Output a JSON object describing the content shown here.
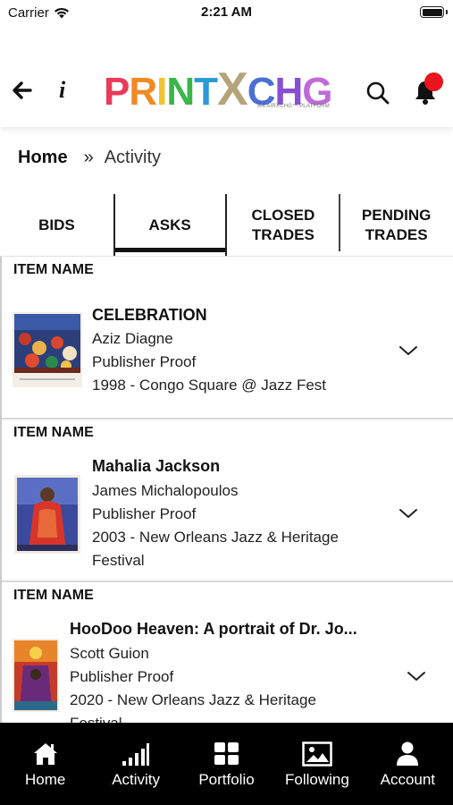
{
  "status": {
    "carrier": "Carrier",
    "time": "2:21 AM"
  },
  "header": {
    "logo": {
      "part1": "PRINT",
      "part2": "X",
      "part3": "CHG",
      "sub": "AN AIRXCHG™ PLATFORM"
    }
  },
  "breadcrumb": {
    "home": "Home",
    "separator": "»",
    "current": "Activity"
  },
  "tabs": [
    {
      "label_line1": "BIDS",
      "label_line2": "",
      "active": false
    },
    {
      "label_line1": "ASKS",
      "label_line2": "",
      "active": true
    },
    {
      "label_line1": "CLOSED",
      "label_line2": "TRADES",
      "active": false
    },
    {
      "label_line1": "PENDING",
      "label_line2": "TRADES",
      "active": false
    }
  ],
  "items": [
    {
      "header": "ITEM NAME",
      "title": "CELEBRATION",
      "artist": "Aziz Diagne",
      "edition": "Publisher Proof",
      "event_line1": "1998 - Congo Square @ Jazz Fest",
      "event_line2": ""
    },
    {
      "header": "ITEM NAME",
      "title": "Mahalia Jackson",
      "artist": "James Michalopoulos",
      "edition": "Publisher Proof",
      "event_line1": "2003 - New Orleans Jazz & Heritage",
      "event_line2": "Festival"
    },
    {
      "header": "ITEM NAME",
      "title": "HooDoo Heaven: A portrait of Dr. Jo...",
      "artist": "Scott Guion",
      "edition": "Publisher Proof",
      "event_line1": "2020 - New Orleans Jazz & Heritage",
      "event_line2": "Festival"
    }
  ],
  "nav": [
    {
      "label": "Home",
      "icon": "home-icon"
    },
    {
      "label": "Activity",
      "icon": "activity-bars-icon"
    },
    {
      "label": "Portfolio",
      "icon": "grid-icon"
    },
    {
      "label": "Following",
      "icon": "image-icon"
    },
    {
      "label": "Account",
      "icon": "user-icon"
    }
  ],
  "colors": {
    "logo_p": "#e83a5a",
    "logo_r": "#f08a24",
    "logo_i": "#f2c230",
    "logo_n": "#3bb54a",
    "logo_t": "#2c9ad6",
    "logo_x": "#b5a37a",
    "logo_c": "#4b6fd3",
    "logo_h": "#8a4fd0",
    "logo_g": "#c06ad8",
    "notification_dot": "#e8141e",
    "nav_background": "#000000"
  }
}
